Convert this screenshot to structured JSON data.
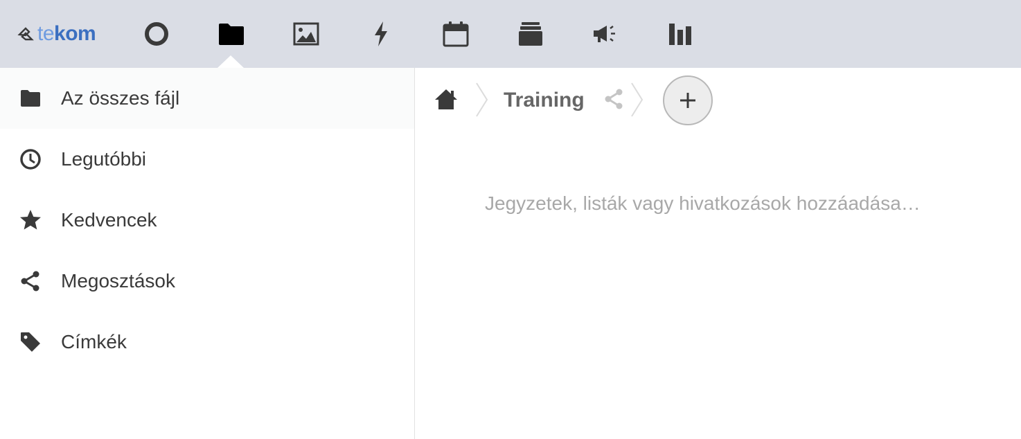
{
  "header": {
    "logo": {
      "prefix": "te",
      "suffix": "kom"
    },
    "apps": [
      {
        "name": "dashboard",
        "icon": "circle-icon"
      },
      {
        "name": "files",
        "icon": "folder-icon",
        "active": true
      },
      {
        "name": "photos",
        "icon": "image-icon"
      },
      {
        "name": "activity",
        "icon": "lightning-icon"
      },
      {
        "name": "calendar",
        "icon": "calendar-icon"
      },
      {
        "name": "deck",
        "icon": "deck-icon"
      },
      {
        "name": "announcements",
        "icon": "megaphone-icon"
      },
      {
        "name": "analytics",
        "icon": "bar-chart-icon"
      }
    ]
  },
  "sidebar": {
    "items": [
      {
        "label": "Az összes fájl",
        "icon": "folder-icon",
        "active": true
      },
      {
        "label": "Legutóbbi",
        "icon": "clock-icon"
      },
      {
        "label": "Kedvencek",
        "icon": "star-icon"
      },
      {
        "label": "Megosztások",
        "icon": "share-icon"
      },
      {
        "label": "Címkék",
        "icon": "tag-icon"
      }
    ]
  },
  "breadcrumb": {
    "home_icon": "home-icon",
    "folder": "Training",
    "share_icon": "share-icon",
    "add_icon": "plus-icon"
  },
  "main": {
    "placeholder": "Jegyzetek, listák vagy hivatkozások hozzáadása…"
  },
  "colors": {
    "header_bg": "#dadde5",
    "logo_blue": "#3b6fc0",
    "icon_dark": "#3a3a3a",
    "muted_text": "#a8a8a8"
  }
}
